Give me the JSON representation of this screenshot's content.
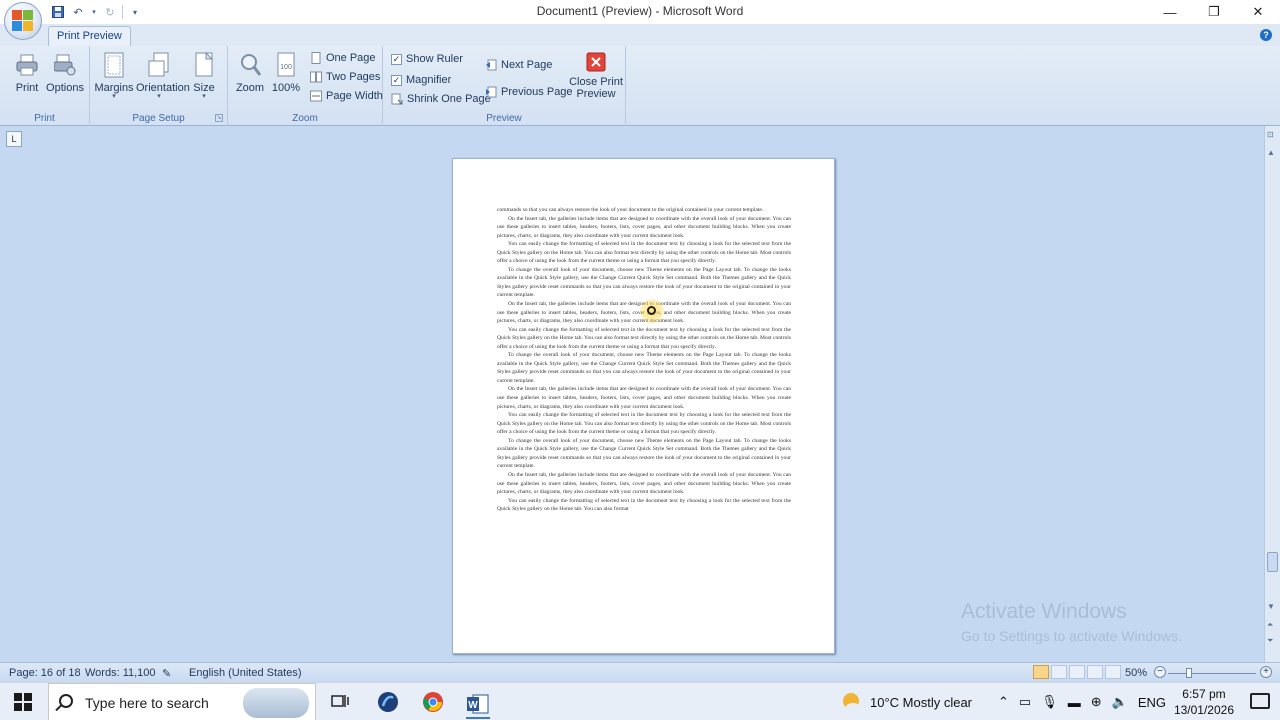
{
  "window": {
    "title": "Document1 (Preview) - Microsoft Word",
    "controls": [
      "minimize",
      "restore",
      "close"
    ]
  },
  "ribbon": {
    "active_tab": "Print Preview",
    "groups": {
      "print": {
        "label": "Print",
        "buttons": {
          "print": "Print",
          "options": "Options"
        }
      },
      "page_setup": {
        "label": "Page Setup",
        "buttons": {
          "margins": "Margins",
          "orientation": "Orientation",
          "size": "Size"
        }
      },
      "zoom": {
        "label": "Zoom",
        "buttons": {
          "zoom": "Zoom",
          "hundred": "100%",
          "one_page": "One Page",
          "two_pages": "Two Pages",
          "page_width": "Page Width"
        }
      },
      "preview": {
        "label": "Preview",
        "show_ruler": "Show Ruler",
        "magnifier": "Magnifier",
        "shrink_one_page": "Shrink One Page",
        "next_page": "Next Page",
        "previous_page": "Previous Page",
        "close_print_preview_1": "Close Print",
        "close_print_preview_2": "Preview",
        "show_ruler_checked": true,
        "magnifier_checked": true
      }
    }
  },
  "document": {
    "paragraphs": [
      {
        "indent": false,
        "text": "commands so that you can always restore the look of your document to the original contained in your current template."
      },
      {
        "indent": true,
        "text": "On the Insert tab, the galleries include items that are designed to coordinate with the overall look of your document. You can use these galleries to insert tables, headers, footers, lists, cover pages, and other document building blocks. When you create pictures, charts, or diagrams, they also coordinate with your current document look."
      },
      {
        "indent": true,
        "text": "You can easily change the formatting of selected text in the document text by choosing a look for the selected text from the Quick Styles gallery on the Home tab. You can also format text directly by using the other controls on the Home tab. Most controls offer a choice of using the look from the current theme or using a format that you specify directly."
      },
      {
        "indent": true,
        "text": "To change the overall look of your document, choose new Theme elements on the Page Layout tab. To change the looks available in the Quick Style gallery, use the Change Current Quick Style Set command. Both the Themes gallery and the Quick Styles gallery provide reset commands so that you can always restore the look of your document to the original contained in your current template."
      },
      {
        "indent": true,
        "text": "On the Insert tab, the galleries include items that are designed to coordinate with the overall look of your document. You can use these galleries to insert tables, headers, footers, lists, cover pages, and other document building blocks. When you create pictures, charts, or diagrams, they also coordinate with your current document look."
      },
      {
        "indent": true,
        "text": "You can easily change the formatting of selected text in the document text by choosing a look for the selected text from the Quick Styles gallery on the Home tab. You can also format text directly by using the other controls on the Home tab. Most controls offer a choice of using the look from the current theme or using a format that you specify directly."
      },
      {
        "indent": true,
        "text": "To change the overall look of your document, choose new Theme elements on the Page Layout tab. To change the looks available in the Quick Style gallery, use the Change Current Quick Style Set command. Both the Themes gallery and the Quick Styles gallery provide reset commands so that you can always restore the look of your document to the original contained in your current template."
      },
      {
        "indent": true,
        "text": "On the Insert tab, the galleries include items that are designed to coordinate with the overall look of your document. You can use these galleries to insert tables, headers, footers, lists, cover pages, and other document building blocks. When you create pictures, charts, or diagrams, they also coordinate with your current document look."
      },
      {
        "indent": true,
        "text": "You can easily change the formatting of selected text in the document text by choosing a look for the selected text from the Quick Styles gallery on the Home tab. You can also format text directly by using the other controls on the Home tab. Most controls offer a choice of using the look from the current theme or using a format that you specify directly."
      },
      {
        "indent": true,
        "text": "To change the overall look of your document, choose new Theme elements on the Page Layout tab. To change the looks available in the Quick Style gallery, use the Change Current Quick Style Set command. Both the Themes gallery and the Quick Styles gallery provide reset commands so that you can always restore the look of your document to the original contained in your current template."
      },
      {
        "indent": true,
        "text": "On the Insert tab, the galleries include items that are designed to coordinate with the overall look of your document. You can use these galleries to insert tables, headers, footers, lists, cover pages, and other document building blocks. When you create pictures, charts, or diagrams, they also coordinate with your current document look."
      },
      {
        "indent": true,
        "text": "You can easily change the formatting of selected text in the document text by choosing a look for the selected text from the Quick Styles gallery on the Home tab. You can also format"
      }
    ]
  },
  "watermark": {
    "line1": "Activate Windows",
    "line2": "Go to Settings to activate Windows."
  },
  "statusbar": {
    "page": "Page: 16 of 18",
    "words": "Words: 11,100",
    "language": "English (United States)",
    "zoom": "50%"
  },
  "taskbar": {
    "search_placeholder": "Type here to search",
    "weather": "10°C  Mostly clear",
    "language": "ENG",
    "time": "6:57 pm",
    "date": "13/01/2026"
  },
  "colors": {
    "ribbon_bg": "#dfe9f5",
    "doc_bg": "#c5d8f1",
    "close_preview_red": "#e0443a",
    "accent": "#15428b"
  }
}
